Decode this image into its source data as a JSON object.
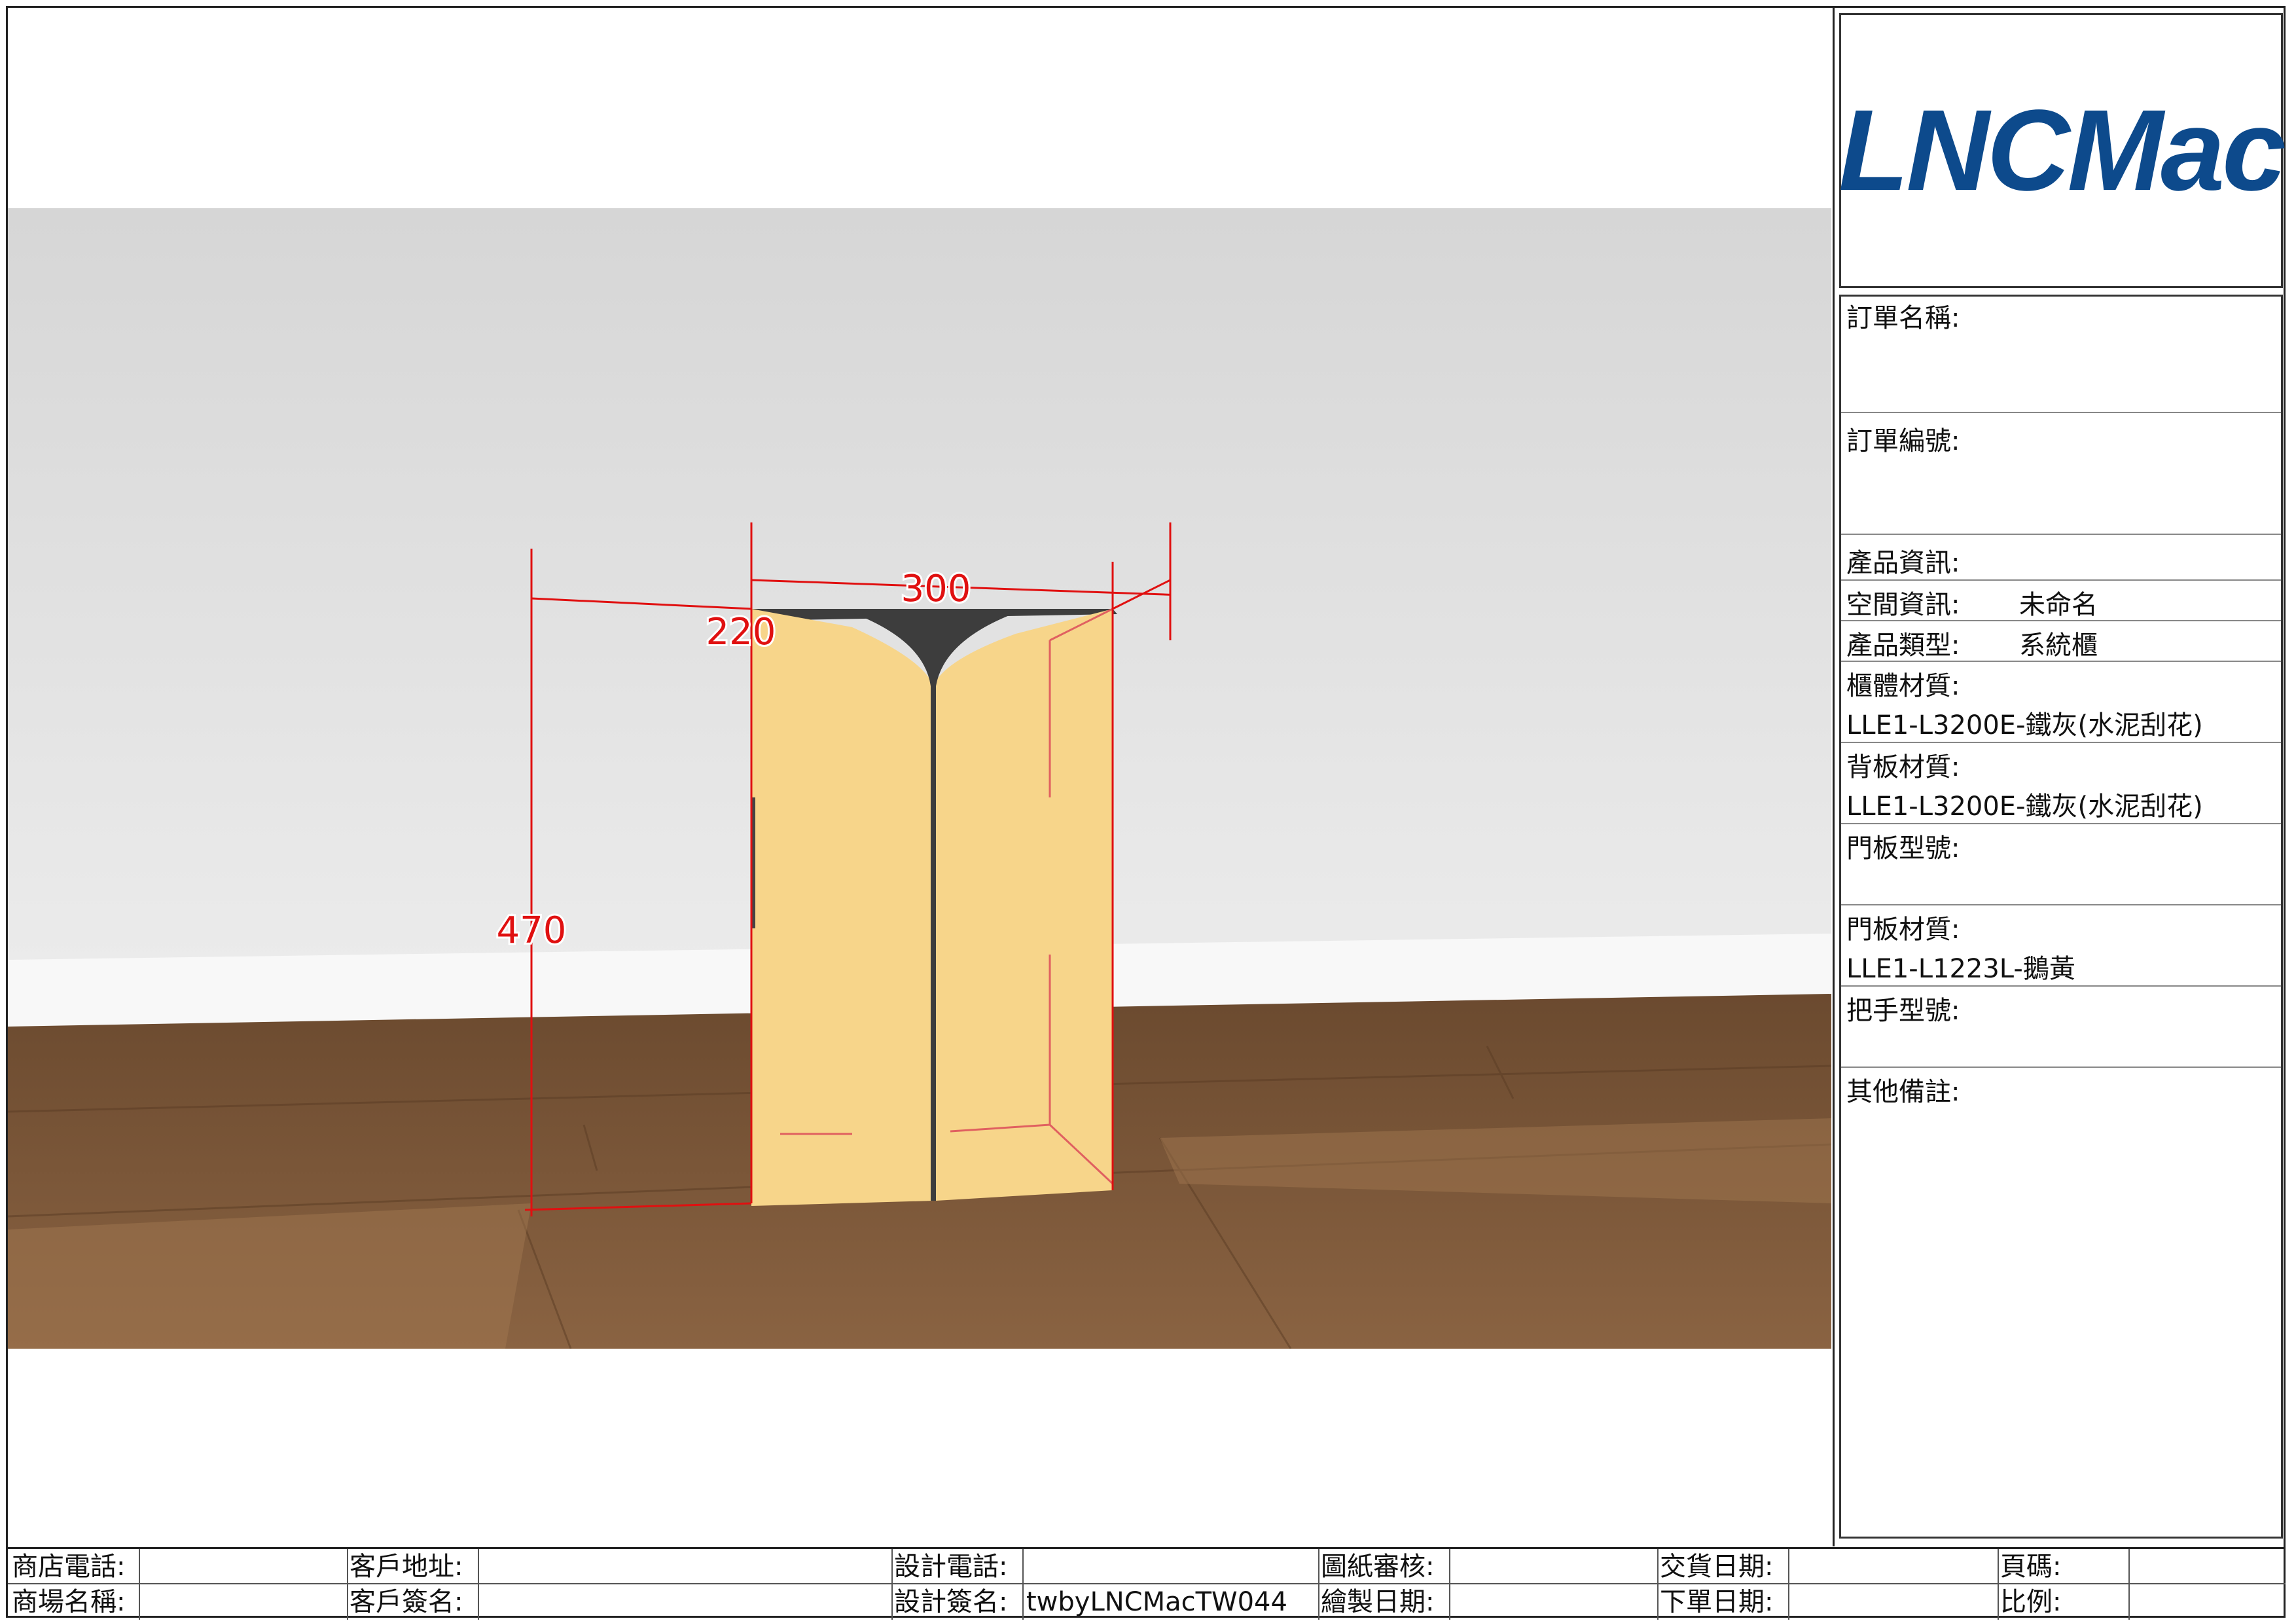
{
  "brand": {
    "logo_text": "LNCMac",
    "logo_color": "#0d4a8c"
  },
  "model": {
    "dimensions": {
      "width": "300",
      "depth": "220",
      "height": "470"
    },
    "colors": {
      "door": "#f7d58a",
      "top": "#3d3d3d",
      "dim_line": "#e01010",
      "wall": "#dcdcdc",
      "floor": "#7a5535"
    }
  },
  "info": {
    "order_name_label": "訂單名稱:",
    "order_no_label": "訂單編號:",
    "product_info_label": "產品資訊:",
    "space_info_label": "空間資訊:",
    "space_info_value": "未命名",
    "product_type_label": "產品類型:",
    "product_type_value": "系統櫃",
    "cabinet_material_label": "櫃體材質:",
    "cabinet_material_value": "LLE1-L3200E-鐵灰(水泥刮花)",
    "back_material_label": "背板材質:",
    "back_material_value": "LLE1-L3200E-鐵灰(水泥刮花)",
    "door_model_label": "門板型號:",
    "door_material_label": "門板材質:",
    "door_material_value": "LLE1-L1223L-鵝黃",
    "handle_model_label": "把手型號:",
    "other_notes_label": "其他備註:"
  },
  "footer": {
    "store_phone": "商店電話:",
    "mall_name": "商場名稱:",
    "customer_address": "客戶地址:",
    "customer_signature": "客戶簽名:",
    "design_phone": "設計電話:",
    "design_signature": "設計簽名:",
    "design_signature_value": "twbyLNCMacTW044",
    "drawing_review": "圖紙審核:",
    "drawing_date": "繪製日期:",
    "delivery_date": "交貨日期:",
    "order_date": "下單日期:",
    "page_no": "頁碼:",
    "scale": "比例:"
  }
}
